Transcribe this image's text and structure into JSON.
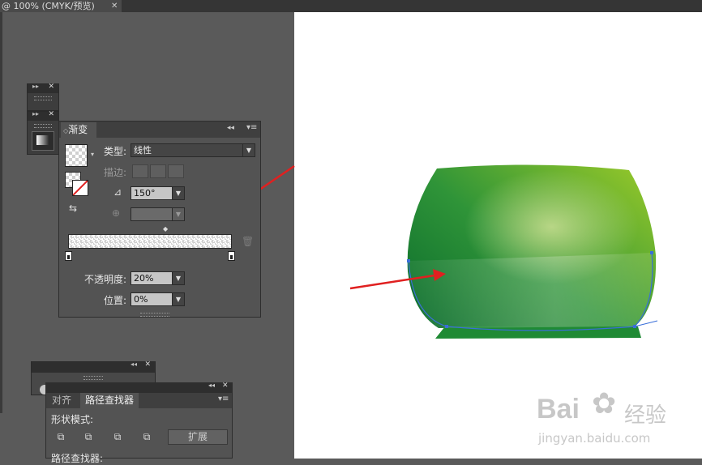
{
  "document": {
    "tab_title": "@ 100% (CMYK/预览)",
    "close": "✕"
  },
  "gradient_panel": {
    "tab": "渐变",
    "collapse": "◂◂",
    "menu": "▾≡",
    "type_label": "类型:",
    "type_value": "线性",
    "stroke_label": "描边:",
    "angle_value": "150°",
    "opacity_label": "不透明度:",
    "opacity_value": "20%",
    "location_label": "位置:",
    "location_value": "0%",
    "angle_icon": "angle-icon",
    "aspect_icon": "aspect-ratio-icon",
    "delete_icon": "trash-icon"
  },
  "pathfinder_panel": {
    "tab_align": "对齐",
    "tab_pathfinder": "路径查找器",
    "shape_modes_label": "形状模式:",
    "expand_label": "扩展",
    "pathfinders_label": "路径查找器:",
    "collapse": "◂◂",
    "close": "✕",
    "menu": "▾≡"
  },
  "mini_panels": {
    "arrows": "▸▸",
    "close": "✕"
  },
  "artwork": {
    "gradient_dark": "#0f7a32",
    "gradient_light": "#8ec12a",
    "highlight": "#b7d67c",
    "path_color": "#3a6fd8",
    "arrow_color": "#e02020"
  },
  "watermark": {
    "brand": "Bai",
    "brand_cn": "经验",
    "url": "jingyan.baidu.com"
  }
}
